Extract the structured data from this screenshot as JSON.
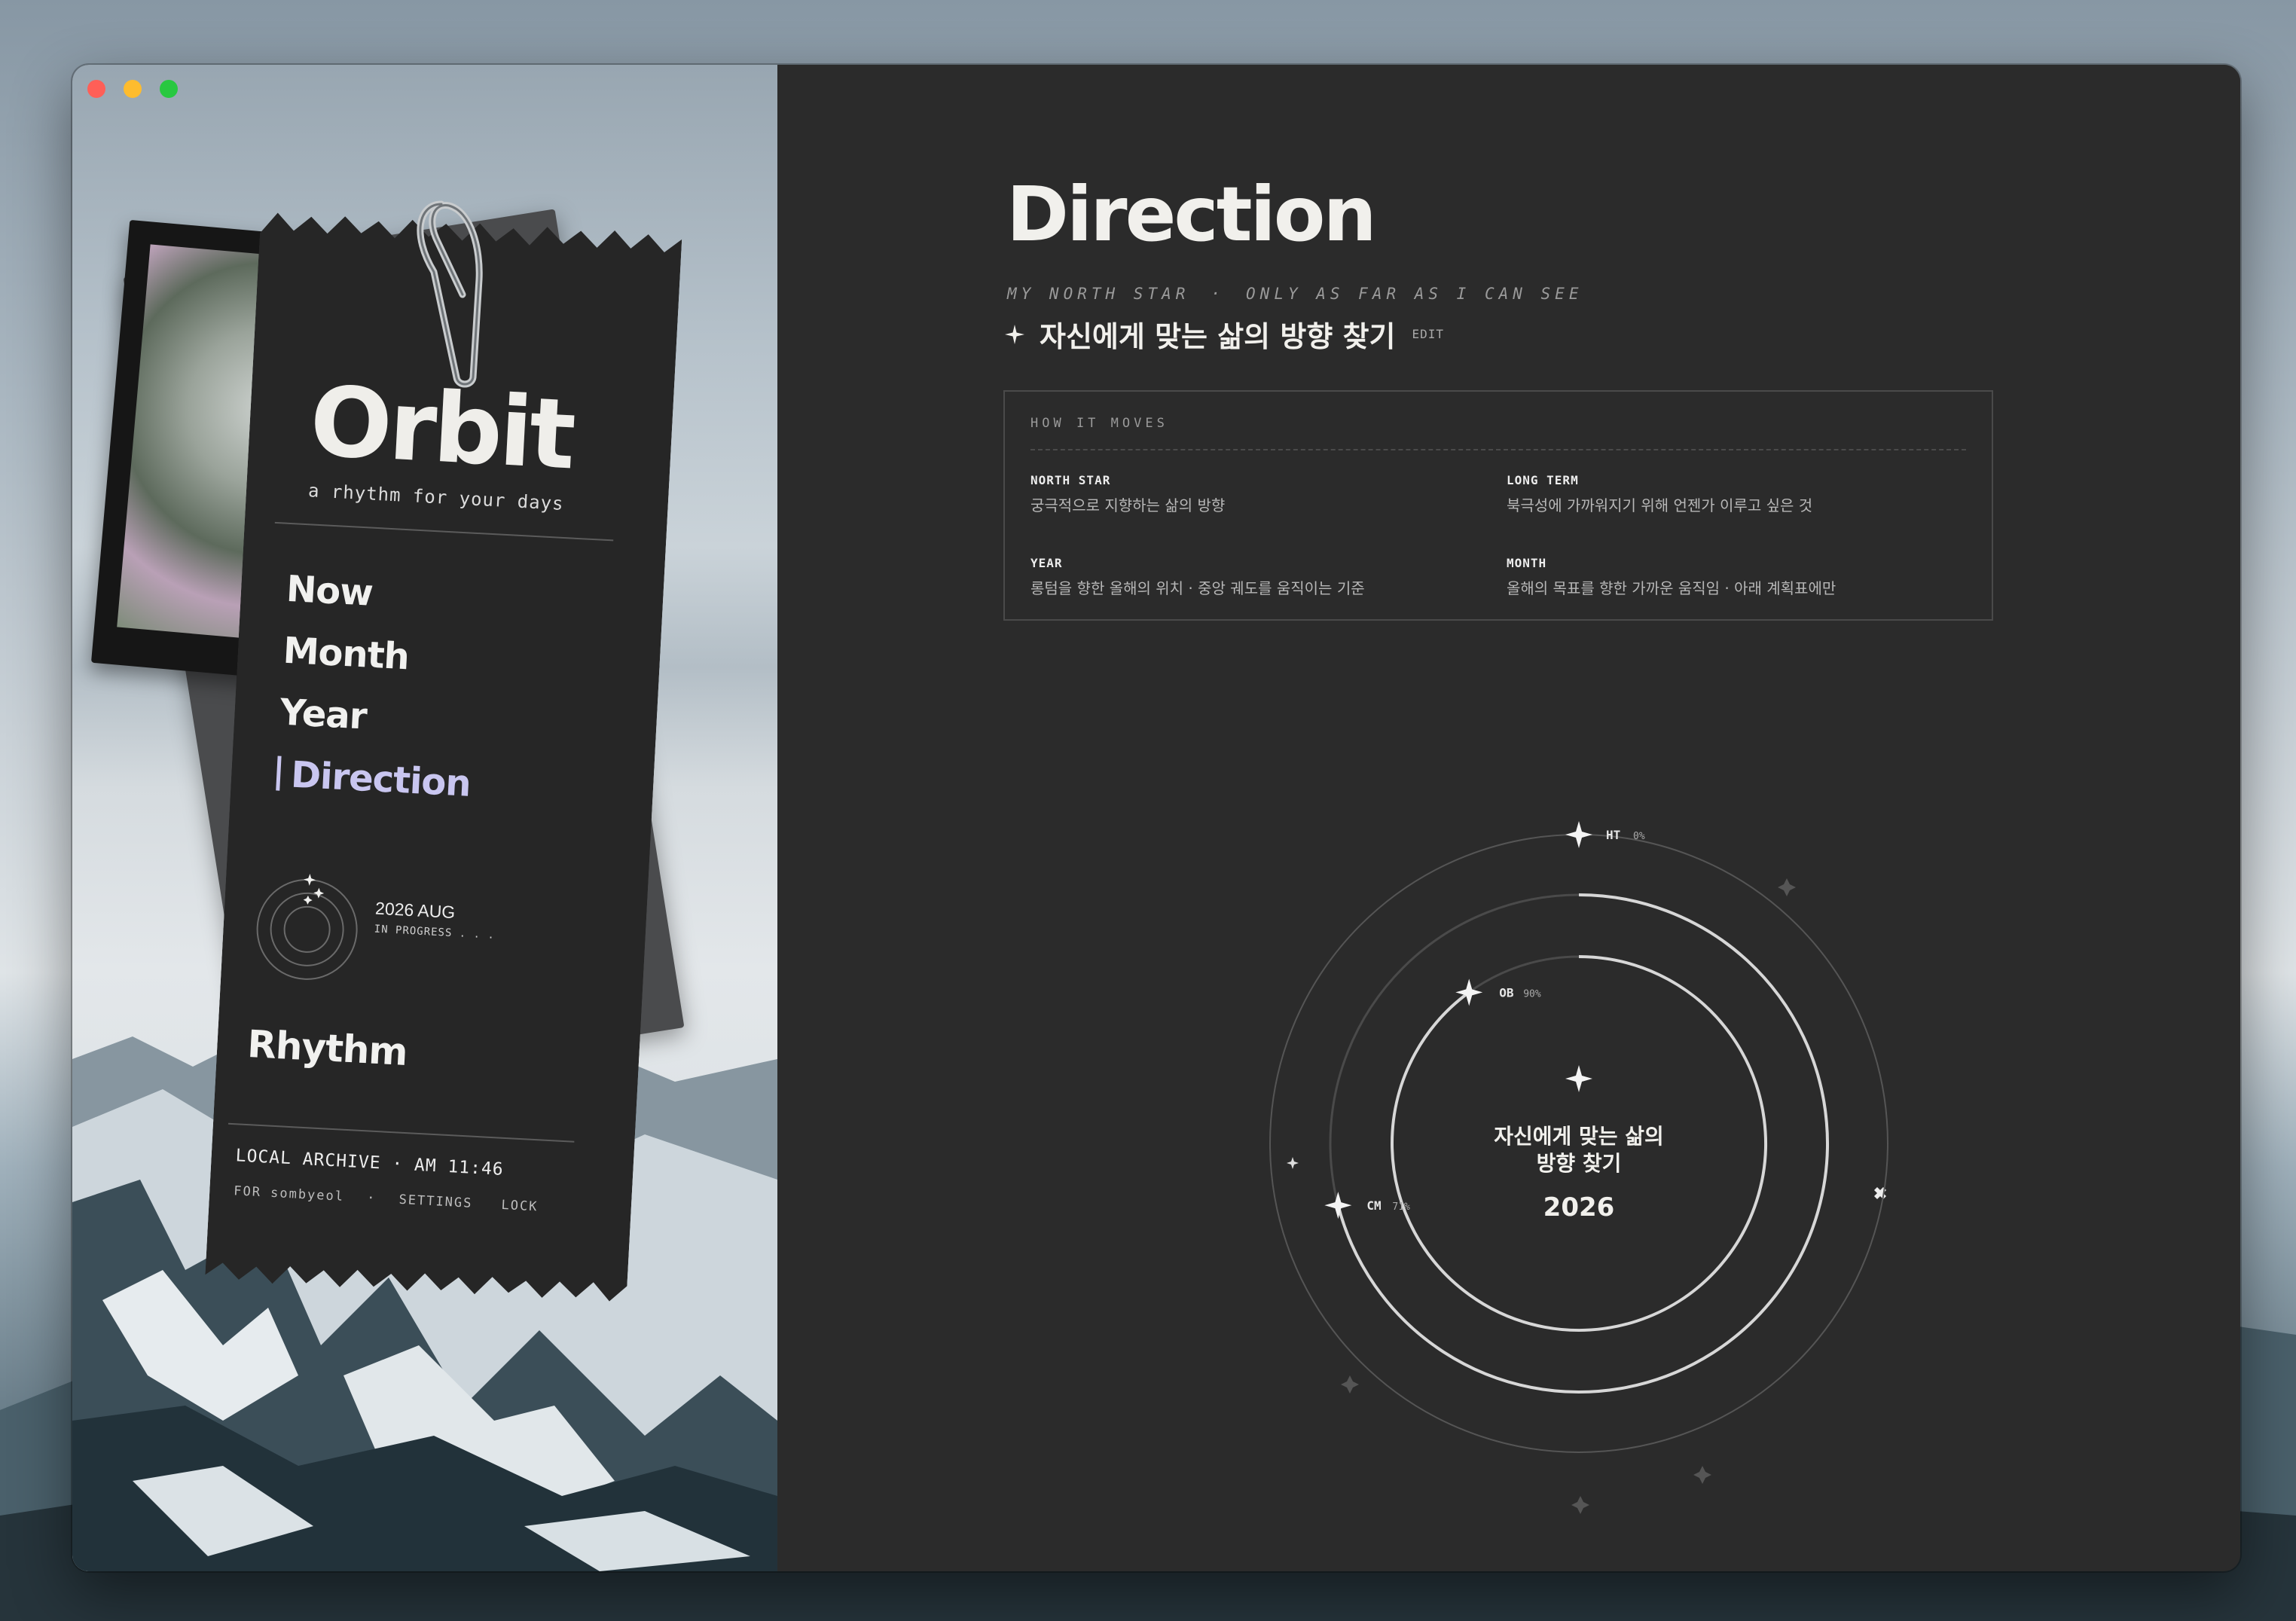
{
  "app": {
    "brand": "Orbit",
    "tagline": "a rhythm for your days"
  },
  "nav": {
    "items": [
      {
        "label": "Now",
        "active": false
      },
      {
        "label": "Month",
        "active": false
      },
      {
        "label": "Year",
        "active": false
      },
      {
        "label": "Direction",
        "active": true
      }
    ],
    "rhythm": "Rhythm"
  },
  "status": {
    "date": "2026 AUG",
    "state": "IN PROGRESS . . ."
  },
  "footer": {
    "archive": "LOCAL ARCHIVE · AM 11:46",
    "user": "FOR sombyeol",
    "settings": "SETTINGS",
    "lock": "LOCK"
  },
  "page": {
    "title": "Direction",
    "subcaption_a": "MY NORTH STAR",
    "subcaption_b": "ONLY AS FAR AS I CAN SEE",
    "goal": "자신에게 맞는 삶의 방향 찾기",
    "edit": "EDIT"
  },
  "how": {
    "heading": "HOW IT MOVES",
    "items": [
      {
        "key": "NORTH STAR",
        "value": "궁극적으로 지향하는 삶의 방향"
      },
      {
        "key": "LONG TERM",
        "value": "북극성에 가까워지기 위해 언젠가 이루고 싶은 것"
      },
      {
        "key": "YEAR",
        "value": "롱텀을 향한 올해의 위치 · 중앙 궤도를 움직이는 기준"
      },
      {
        "key": "MONTH",
        "value": "올해의 목표를 향한 가까운 움직임 · 아래 계획표에만"
      }
    ]
  },
  "orbit": {
    "center_line1": "자신에게 맞는 삶의",
    "center_line2": "방향 찾기",
    "year": "2026",
    "markers": [
      {
        "label": "HT",
        "pct": "0%",
        "progress": 0
      },
      {
        "label": "OB",
        "pct": "90%",
        "progress": 0.9
      },
      {
        "label": "CM",
        "pct": "71%",
        "progress": 0.71
      }
    ]
  },
  "colors": {
    "accent": "#c9c6f0",
    "panel": "#2b2b2b",
    "ticket": "#262626",
    "text": "#f1f0ec"
  }
}
